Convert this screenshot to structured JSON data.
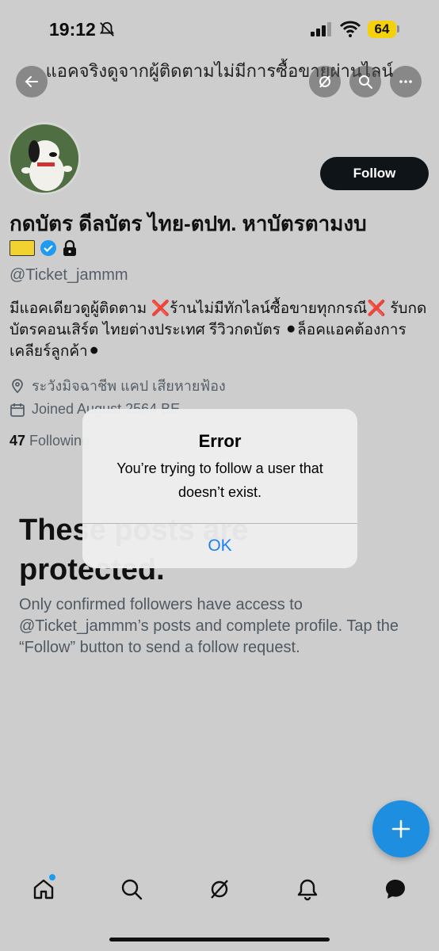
{
  "status_bar": {
    "time": "19:12",
    "battery": "64"
  },
  "header": {
    "title": "แอคจริงดูจากผู้ติดตามไม่มีการซื้อขายผ่านไลน์"
  },
  "profile": {
    "follow_label": "Follow",
    "display_name": "กดบัตร ดีลบัตร ไทย-ตปท. หาบัตรตามงบ",
    "handle": "@Ticket_jammm",
    "bio": "มีแอคเดียวดูผู้ติดตาม ❌ร้านไม่มีทักไลน์ซื้อขายทุกกรณี❌ รับกดบัตรคอนเสิร์ต ไทยต่างประเทศ รีวิวกดบัตร ⚫ล็อคแอคต้องการเคลียร์ลูกค้า⚫",
    "location": "ระวังมิจฉาชีพ แคป เสียหายฟ้อง",
    "joined": "Joined August 2564 BE",
    "following_count": "47",
    "following_label": "Following"
  },
  "protected": {
    "title_line1": "These posts are",
    "title_line2": "protected.",
    "description": "Only confirmed followers have access to @Ticket_jammm’s posts and complete profile. Tap the “Follow” button to send a follow request."
  },
  "alert": {
    "title": "Error",
    "message": "You’re trying to follow a user that doesn’t exist.",
    "ok_label": "OK"
  },
  "colors": {
    "accent": "#1d9bf0",
    "ok_blue": "#1e7ef5",
    "battery": "#f5d10c"
  },
  "icons": [
    "bell-off-icon",
    "signal-icon",
    "wifi-icon",
    "back-arrow-icon",
    "grok-icon",
    "search-icon",
    "more-icon",
    "verified-icon",
    "lock-icon",
    "location-icon",
    "calendar-icon",
    "plus-icon",
    "home-icon",
    "bell-icon",
    "messages-icon"
  ]
}
